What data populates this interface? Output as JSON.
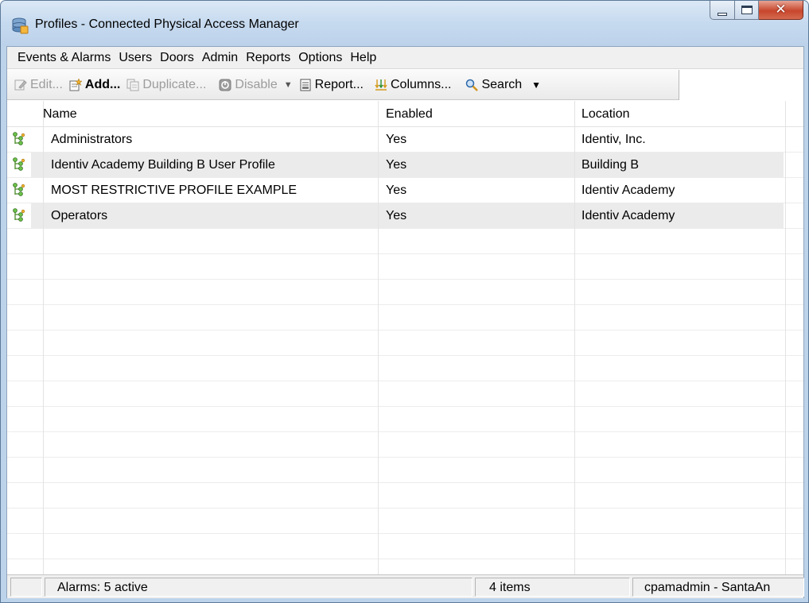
{
  "window": {
    "title": "Profiles - Connected Physical Access Manager"
  },
  "menu": [
    "Events & Alarms",
    "Users",
    "Doors",
    "Admin",
    "Reports",
    "Options",
    "Help"
  ],
  "toolbar": {
    "edit": "Edit...",
    "add": "Add...",
    "duplicate": "Duplicate...",
    "disable": "Disable",
    "report": "Report...",
    "columns": "Columns...",
    "search": "Search"
  },
  "table": {
    "columns": [
      "Name",
      "Enabled",
      "Location"
    ],
    "rows": [
      {
        "name": "Administrators",
        "enabled": "Yes",
        "location": "Identiv, Inc."
      },
      {
        "name": "Identiv Academy Building B User Profile",
        "enabled": "Yes",
        "location": "Building B"
      },
      {
        "name": "MOST RESTRICTIVE PROFILE EXAMPLE",
        "enabled": "Yes",
        "location": "Identiv Academy"
      },
      {
        "name": "Operators",
        "enabled": "Yes",
        "location": "Identiv Academy"
      }
    ]
  },
  "statusbar": {
    "alarms": "Alarms: 5 active",
    "items": "4 items",
    "user": "cpamadmin - SantaAn"
  },
  "icons": {
    "app": "database-icon",
    "row": "profile-tree-icon"
  }
}
